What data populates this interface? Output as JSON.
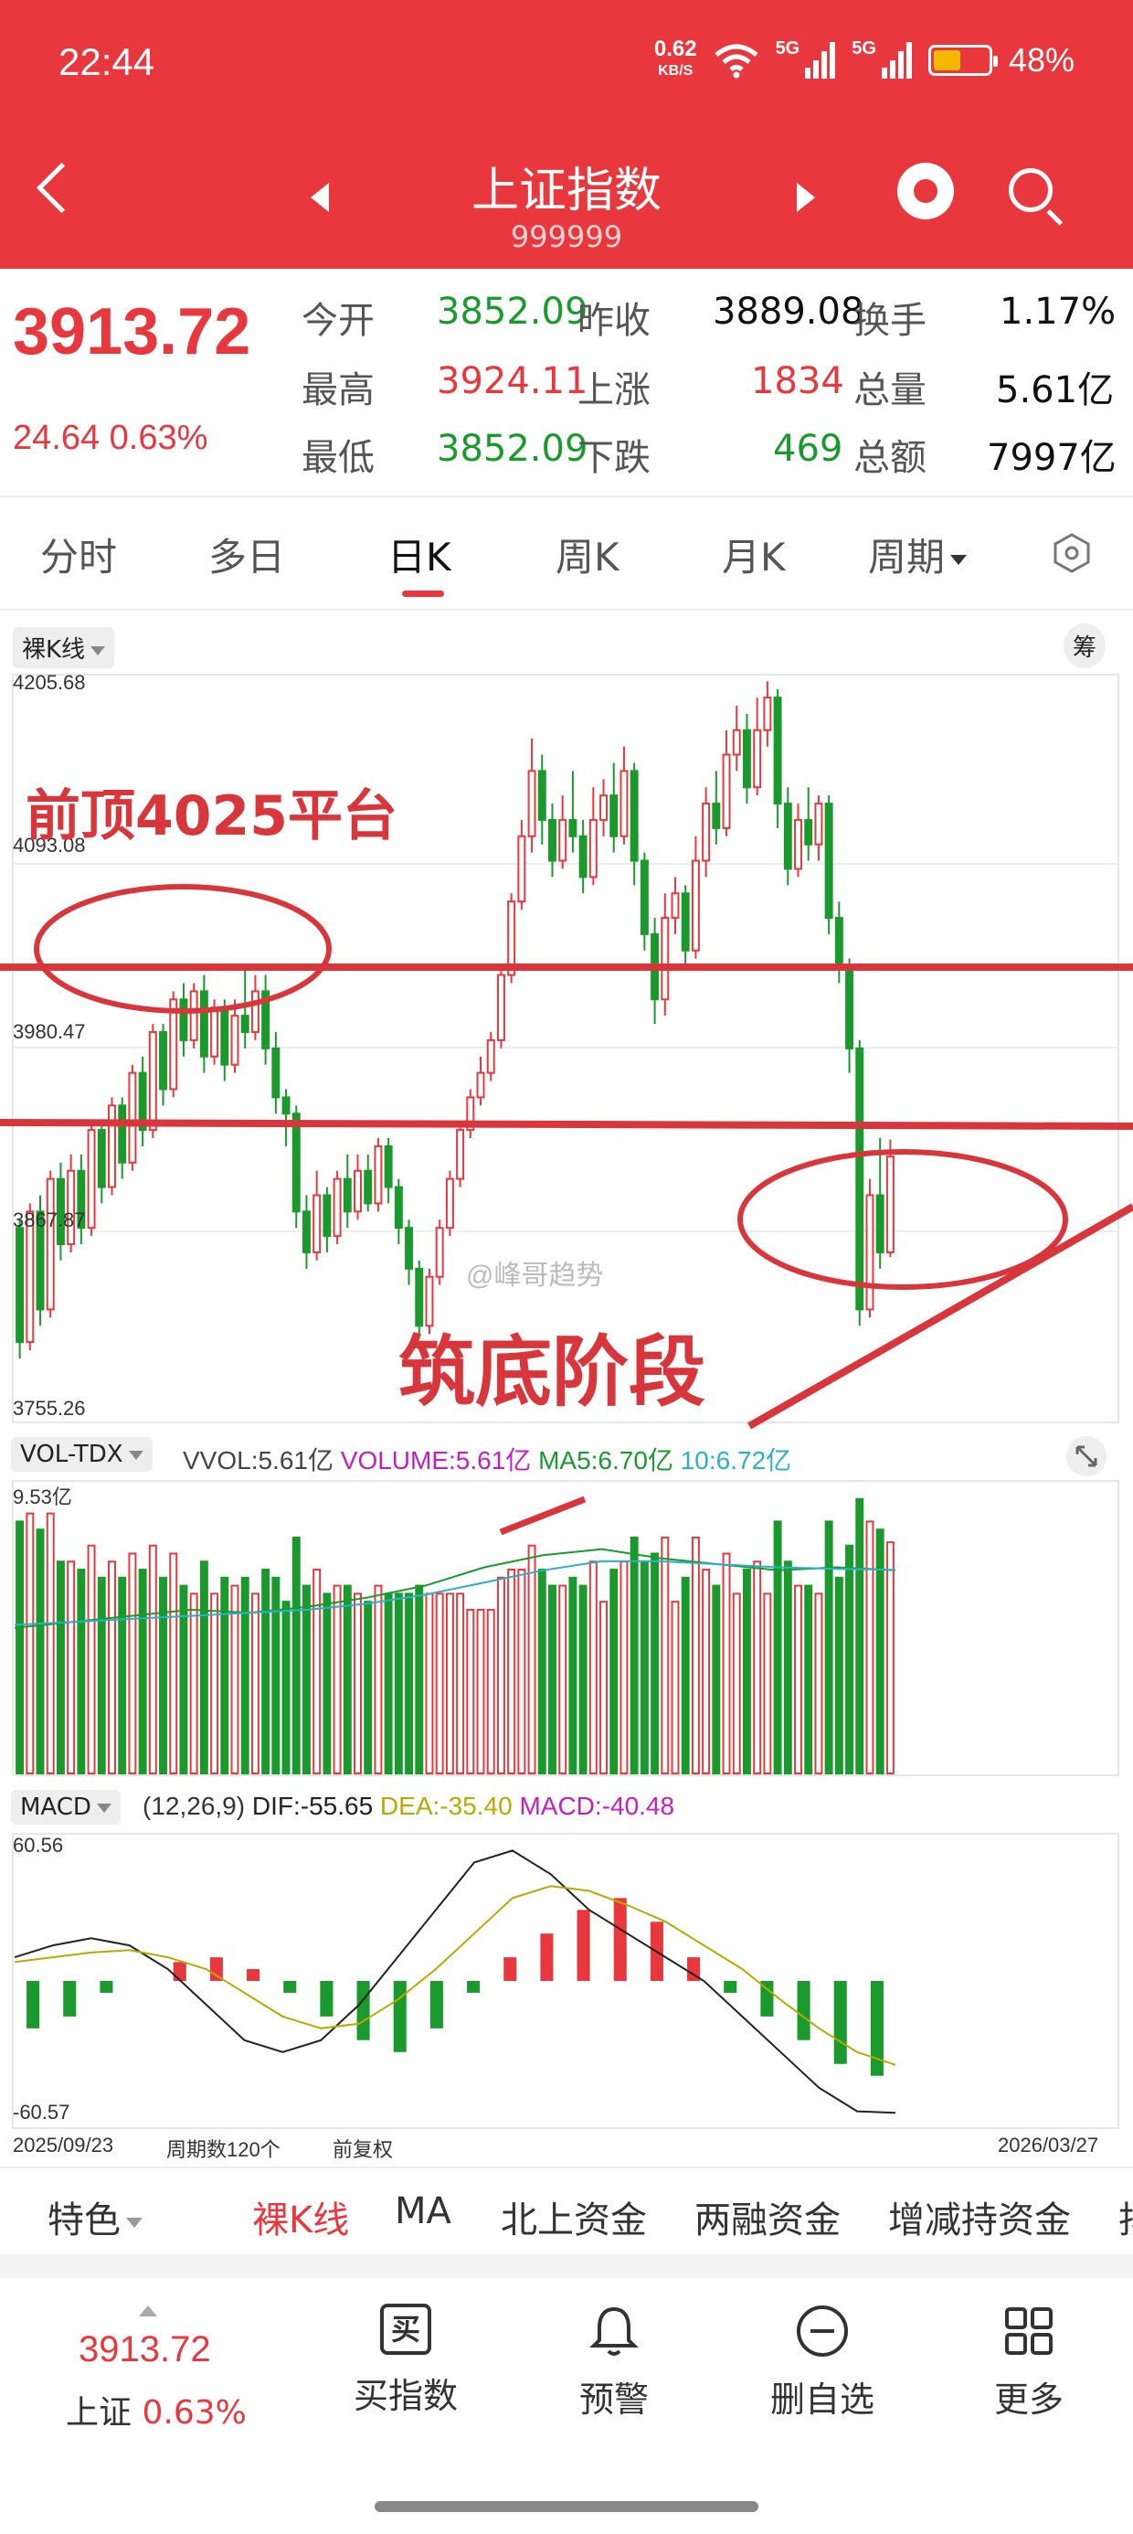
{
  "status_bar": {
    "time": "22:44",
    "net_speed": "0.62",
    "net_unit": "KB/S",
    "sig1": "5G",
    "sig2": "5G",
    "battery": "48%"
  },
  "header": {
    "title": "上证指数",
    "code": "999999"
  },
  "quote": {
    "price": "3913.72",
    "change": "24.64",
    "change_pct": "0.63%",
    "open_label": "今开",
    "open": "3852.09",
    "prev_close_label": "昨收",
    "prev_close": "3889.08",
    "turnover_label": "换手",
    "turnover": "1.17%",
    "high_label": "最高",
    "high": "3924.11",
    "up_label": "上涨",
    "up": "1834",
    "volume_label": "总量",
    "volume": "5.61亿",
    "low_label": "最低",
    "low": "3852.09",
    "down_label": "下跌",
    "down": "469",
    "amount_label": "总额",
    "amount": "7997亿"
  },
  "tabs": [
    "分时",
    "多日",
    "日K",
    "周K",
    "月K",
    "周期"
  ],
  "chart": {
    "mode_label": "裸K线",
    "chip_label": "筹",
    "y_ticks": [
      "4205.68",
      "4093.08",
      "3980.47",
      "3867.87",
      "3755.26"
    ],
    "annotation_top": "前顶4025平台",
    "annotation_bottom": "筑底阶段",
    "watermark": "@峰哥趋势",
    "vol_label": "VOL-TDX",
    "vvol": "VVOL:5.61亿",
    "volume": "VOLUME:5.61亿",
    "ma5": "MA5:6.70亿",
    "ma10": "10:6.72亿",
    "vol_max": "9.53亿",
    "macd_label": "MACD",
    "macd_params": "(12,26,9)",
    "dif": "DIF:-55.65",
    "dea": "DEA:-35.40",
    "macd": "MACD:-40.48",
    "macd_max": "60.56",
    "macd_min": "-60.57",
    "date_start": "2025/09/23",
    "period_count": "周期数120个",
    "adjust": "前复权",
    "date_end": "2026/03/27"
  },
  "chart_data": {
    "type": "candlestick",
    "ylim": [
      3755.26,
      4205.68
    ],
    "candles": [
      [
        3870,
        3800,
        3875,
        3790
      ],
      [
        3800,
        3880,
        3885,
        3795
      ],
      [
        3880,
        3820,
        3890,
        3810
      ],
      [
        3820,
        3900,
        3905,
        3815
      ],
      [
        3900,
        3860,
        3910,
        3850
      ],
      [
        3860,
        3905,
        3915,
        3855
      ],
      [
        3905,
        3870,
        3915,
        3860
      ],
      [
        3870,
        3930,
        3935,
        3865
      ],
      [
        3930,
        3895,
        3935,
        3885
      ],
      [
        3895,
        3945,
        3950,
        3890
      ],
      [
        3945,
        3910,
        3950,
        3900
      ],
      [
        3910,
        3965,
        3970,
        3905
      ],
      [
        3965,
        3930,
        3975,
        3920
      ],
      [
        3930,
        3990,
        3995,
        3925
      ],
      [
        3990,
        3955,
        3995,
        3945
      ],
      [
        3955,
        4010,
        4015,
        3950
      ],
      [
        4010,
        3985,
        4020,
        3975
      ],
      [
        3985,
        4015,
        4020,
        3980
      ],
      [
        4015,
        3975,
        4025,
        3965
      ],
      [
        3975,
        4005,
        4010,
        3970
      ],
      [
        4005,
        3970,
        4010,
        3960
      ],
      [
        3970,
        4000,
        4010,
        3965
      ],
      [
        4000,
        3990,
        4030,
        3980
      ],
      [
        3990,
        4015,
        4025,
        3985
      ],
      [
        4015,
        3980,
        4025,
        3970
      ],
      [
        3980,
        3950,
        3990,
        3940
      ],
      [
        3950,
        3940,
        3955,
        3920
      ],
      [
        3940,
        3880,
        3945,
        3870
      ],
      [
        3880,
        3855,
        3890,
        3845
      ],
      [
        3855,
        3890,
        3905,
        3850
      ],
      [
        3890,
        3865,
        3895,
        3855
      ],
      [
        3865,
        3900,
        3905,
        3860
      ],
      [
        3900,
        3880,
        3915,
        3870
      ],
      [
        3880,
        3905,
        3915,
        3875
      ],
      [
        3905,
        3885,
        3915,
        3880
      ],
      [
        3885,
        3920,
        3925,
        3880
      ],
      [
        3920,
        3895,
        3925,
        3885
      ],
      [
        3895,
        3870,
        3900,
        3860
      ],
      [
        3870,
        3845,
        3875,
        3835
      ],
      [
        3845,
        3810,
        3850,
        3805
      ],
      [
        3810,
        3840,
        3845,
        3805
      ],
      [
        3840,
        3870,
        3875,
        3835
      ],
      [
        3870,
        3900,
        3905,
        3865
      ],
      [
        3900,
        3930,
        3935,
        3895
      ],
      [
        3930,
        3950,
        3955,
        3925
      ],
      [
        3950,
        3965,
        3975,
        3945
      ],
      [
        3965,
        3985,
        3990,
        3960
      ],
      [
        3985,
        4025,
        4030,
        3980
      ],
      [
        4025,
        4070,
        4075,
        4020
      ],
      [
        4070,
        4110,
        4120,
        4065
      ],
      [
        4110,
        4150,
        4170,
        4100
      ],
      [
        4150,
        4120,
        4160,
        4105
      ],
      [
        4120,
        4095,
        4130,
        4085
      ],
      [
        4095,
        4120,
        4135,
        4090
      ],
      [
        4120,
        4110,
        4150,
        4100
      ],
      [
        4110,
        4085,
        4120,
        4075
      ],
      [
        4085,
        4120,
        4140,
        4080
      ],
      [
        4120,
        4135,
        4145,
        4110
      ],
      [
        4135,
        4110,
        4155,
        4100
      ],
      [
        4110,
        4150,
        4165,
        4105
      ],
      [
        4150,
        4095,
        4155,
        4080
      ],
      [
        4095,
        4050,
        4100,
        4040
      ],
      [
        4050,
        4010,
        4060,
        3995
      ],
      [
        4010,
        4060,
        4075,
        4000
      ],
      [
        4060,
        4075,
        4085,
        4050
      ],
      [
        4075,
        4040,
        4080,
        4030
      ],
      [
        4040,
        4095,
        4110,
        4035
      ],
      [
        4095,
        4130,
        4140,
        4085
      ],
      [
        4130,
        4115,
        4150,
        4105
      ],
      [
        4115,
        4160,
        4175,
        4110
      ],
      [
        4160,
        4175,
        4190,
        4150
      ],
      [
        4175,
        4140,
        4185,
        4130
      ],
      [
        4140,
        4175,
        4195,
        4135
      ],
      [
        4175,
        4195,
        4205,
        4165
      ],
      [
        4195,
        4130,
        4200,
        4115
      ],
      [
        4130,
        4090,
        4140,
        4080
      ],
      [
        4090,
        4120,
        4130,
        4085
      ],
      [
        4120,
        4105,
        4140,
        4095
      ],
      [
        4105,
        4130,
        4135,
        4095
      ],
      [
        4130,
        4060,
        4135,
        4050
      ],
      [
        4060,
        4030,
        4070,
        4020
      ],
      [
        4030,
        3980,
        4035,
        3965
      ],
      [
        3980,
        3820,
        3985,
        3810
      ],
      [
        3820,
        3890,
        3900,
        3815
      ],
      [
        3890,
        3855,
        3925,
        3845
      ],
      [
        3855,
        3913.72,
        3924.11,
        3852.09
      ]
    ],
    "ma5": [
      4.8,
      5.0,
      5.2,
      5.4,
      5.3,
      5.5,
      5.8,
      6.2,
      6.8,
      7.2,
      7.4,
      7.1,
      6.9,
      6.7,
      6.8,
      6.7
    ],
    "ma10": [
      4.9,
      5.0,
      5.1,
      5.2,
      5.3,
      5.4,
      5.6,
      5.9,
      6.3,
      6.7,
      7.0,
      7.0,
      6.9,
      6.8,
      6.75,
      6.72
    ],
    "macd_hist": [
      -20,
      -15,
      -5,
      0,
      8,
      10,
      5,
      -5,
      -15,
      -25,
      -30,
      -20,
      -5,
      10,
      20,
      30,
      35,
      25,
      10,
      -5,
      -15,
      -25,
      -35,
      -40
    ],
    "dif": [
      10,
      15,
      18,
      15,
      5,
      -10,
      -25,
      -30,
      -25,
      -10,
      10,
      30,
      50,
      55,
      45,
      30,
      20,
      10,
      0,
      -15,
      -30,
      -45,
      -55,
      -55.65
    ],
    "dea": [
      8,
      10,
      12,
      13,
      10,
      5,
      -5,
      -15,
      -20,
      -18,
      -8,
      5,
      20,
      35,
      40,
      38,
      32,
      25,
      15,
      5,
      -8,
      -20,
      -30,
      -35.4
    ],
    "vol_max": 9.53
  },
  "bottom_tabs": [
    "特色",
    "裸K线",
    "MA",
    "北上资金",
    "两融资金",
    "增减持资金",
    "抖"
  ],
  "bottom_nav": {
    "price": "3913.72",
    "name": "上证",
    "pct": "0.63%",
    "buy": "买指数",
    "alert": "预警",
    "remove": "删自选",
    "more": "更多",
    "buy_glyph": "买"
  },
  "colors": {
    "red": "#e8383d",
    "green": "#1a9a2d",
    "annotation": "#d9363c"
  }
}
